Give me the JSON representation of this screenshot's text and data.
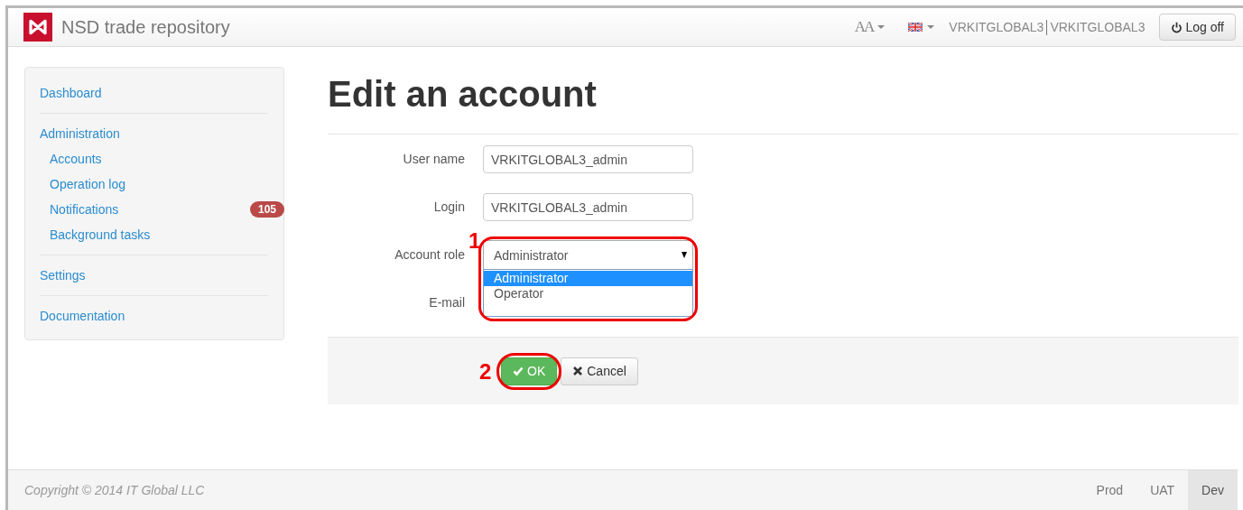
{
  "navbar": {
    "brand": "NSD trade repository",
    "font_menu": "AA",
    "user": "VRKITGLOBAL3",
    "organization": "VRKITGLOBAL3",
    "logoff": "Log off"
  },
  "sidebar": {
    "groups": [
      {
        "items": [
          {
            "label": "Dashboard"
          }
        ]
      },
      {
        "items": [
          {
            "label": "Administration",
            "children": [
              {
                "label": "Accounts"
              },
              {
                "label": "Operation log"
              },
              {
                "label": "Notifications",
                "badge": "105"
              },
              {
                "label": "Background tasks"
              }
            ]
          }
        ]
      },
      {
        "items": [
          {
            "label": "Settings"
          }
        ]
      },
      {
        "items": [
          {
            "label": "Documentation"
          }
        ]
      }
    ]
  },
  "page": {
    "title": "Edit an account"
  },
  "form": {
    "fields": [
      {
        "kind": "text",
        "label": "User name",
        "value": "VRKITGLOBAL3_admin"
      },
      {
        "kind": "text",
        "label": "Login",
        "value": "VRKITGLOBAL3_admin"
      },
      {
        "kind": "select",
        "label": "Account role",
        "value": "Administrator",
        "expanded": true,
        "options": [
          {
            "label": "Administrator",
            "selected": true
          },
          {
            "label": "Operator",
            "selected": false
          }
        ],
        "annotation": "1"
      },
      {
        "kind": "email",
        "label": "E-mail"
      }
    ],
    "buttons": [
      {
        "kind": "primary",
        "label": "OK",
        "annotation": "2"
      },
      {
        "kind": "default",
        "label": "Cancel"
      }
    ]
  },
  "footer": {
    "copyright": "Copyright © 2014 IT Global LLC",
    "environments": [
      {
        "label": "Prod",
        "selected": false
      },
      {
        "label": "UAT",
        "selected": false
      },
      {
        "label": "Dev",
        "selected": true
      }
    ]
  }
}
